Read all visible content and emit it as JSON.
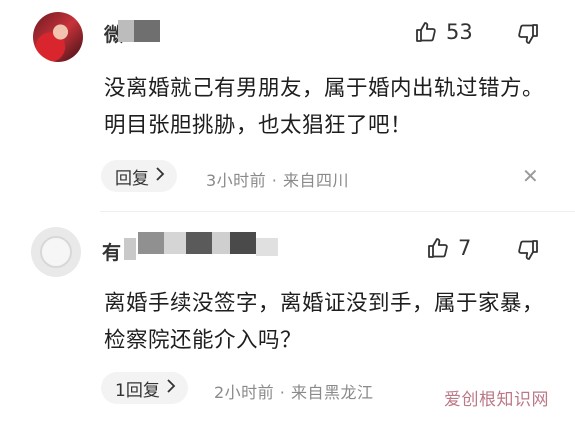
{
  "comments": [
    {
      "username": "微",
      "likes": "53",
      "text": "没离婚就己有男朋友，属于婚内出轨过错方。明目张胆挑胁，也太猖狂了吧！",
      "reply_label": "回复",
      "meta": "3小时前 · 来自四川"
    },
    {
      "username": "有",
      "likes": "7",
      "text": "离婚手续没签字，离婚证没到手，属于家暴，检察院还能介入吗？",
      "reply_label": "1回复",
      "meta": "2小时前 · 来自黑龙江"
    }
  ],
  "watermark": "爱创根知识网",
  "icons": {
    "like": "thumbs-up-icon",
    "dislike": "thumbs-down-icon",
    "chevron": "chevron-right-icon",
    "close": "close-icon"
  }
}
